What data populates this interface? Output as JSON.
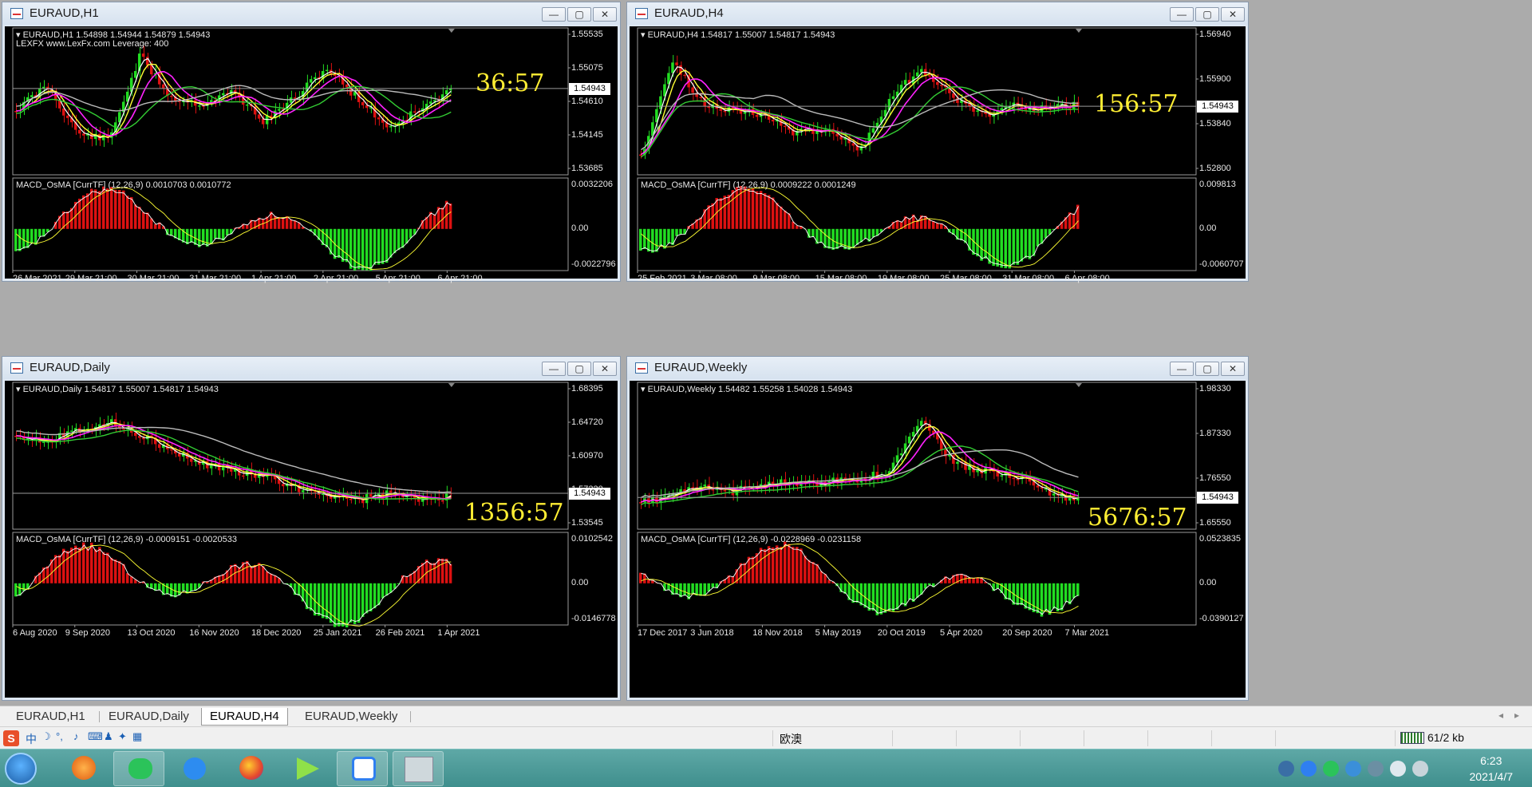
{
  "windows": {
    "h1": {
      "title": "EURAUD,H1",
      "info1": "EURAUD,H1  1.54898 1.54944 1.54879 1.54943",
      "info2": "LEXFX www.LexFx.com Leverage: 400",
      "timer": "36:57",
      "price_tag": "1.54943",
      "price_axis": [
        "1.55535",
        "1.55075",
        "1.54610",
        "1.54145",
        "1.53685"
      ],
      "macd_label": "MACD_OsMA [CurrTF] (12,26,9) 0.0010703 0.0010772",
      "macd_axis": [
        "0.0032206",
        "0.00",
        "-0.0022796"
      ],
      "dates": [
        "26 Mar 2021",
        "29 Mar 21:00",
        "30 Mar 21:00",
        "31 Mar 21:00",
        "1 Apr 21:00",
        "2 Apr 21:00",
        "5 Apr 21:00",
        "6 Apr 21:00"
      ]
    },
    "h4": {
      "title": "EURAUD,H4",
      "info1": "EURAUD,H4  1.54817 1.55007 1.54817 1.54943",
      "timer": "156:57",
      "price_tag": "1.54943",
      "price_axis": [
        "1.56940",
        "1.55900",
        "1.53840",
        "1.52800"
      ],
      "macd_label": "MACD_OsMA [CurrTF] (12,26,9) 0.0009222 0.0001249",
      "macd_axis": [
        "0.009813",
        "0.00",
        "-0.0060707"
      ],
      "dates": [
        "25 Feb 2021",
        "3 Mar 08:00",
        "9 Mar 08:00",
        "15 Mar 08:00",
        "19 Mar 08:00",
        "25 Mar 08:00",
        "31 Mar 08:00",
        "6 Apr 08:00"
      ]
    },
    "daily": {
      "title": "EURAUD,Daily",
      "info1": "EURAUD,Daily  1.54817 1.55007 1.54817 1.54943",
      "timer": "1356:57",
      "price_tag": "1.54943",
      "price_axis": [
        "1.68395",
        "1.64720",
        "1.60970",
        "1.57220",
        "1.53545"
      ],
      "macd_label": "MACD_OsMA [CurrTF] (12,26,9) -0.0009151 -0.0020533",
      "macd_axis": [
        "0.0102542",
        "0.00",
        "-0.0146778"
      ],
      "dates": [
        "6 Aug 2020",
        "9 Sep 2020",
        "13 Oct 2020",
        "16 Nov 2020",
        "18 Dec 2020",
        "25 Jan 2021",
        "26 Feb 2021",
        "1 Apr 2021"
      ]
    },
    "weekly": {
      "title": "EURAUD,Weekly",
      "info1": "EURAUD,Weekly  1.54482 1.55258 1.54028 1.54943",
      "timer": "5676:57",
      "price_tag": "1.54943",
      "price_axis": [
        "1.98330",
        "1.87330",
        "1.76550",
        "1.65550"
      ],
      "macd_label": "MACD_OsMA [CurrTF] (12,26,9) -0.0228969 -0.0231158",
      "macd_axis": [
        "0.0523835",
        "0.00",
        "-0.0390127"
      ],
      "dates": [
        "17 Dec 2017",
        "3 Jun 2018",
        "18 Nov 2018",
        "5 May 2019",
        "20 Oct 2019",
        "5 Apr 2020",
        "20 Sep 2020",
        "7 Mar 2021"
      ]
    }
  },
  "window_buttons": {
    "minimize": "—",
    "maximize": "▢",
    "close": "✕"
  },
  "tabs": [
    "EURAUD,H1",
    "EURAUD,Daily",
    "EURAUD,H4",
    "EURAUD,Weekly"
  ],
  "active_tab": "EURAUD,H4",
  "status": {
    "profile": "欧澳",
    "traffic": "61/2 kb"
  },
  "ime": {
    "mode": "中"
  },
  "clock": {
    "time": "6:23",
    "date": "2021/4/7"
  },
  "colors": {
    "bull": "#22dd22",
    "bear": "#dd1111",
    "ma_yellow": "#ffff33",
    "ma_magenta": "#ff22ff",
    "ma_green": "#33cc33",
    "ma_gray": "#bbbbbb",
    "timer": "#ffee33"
  }
}
